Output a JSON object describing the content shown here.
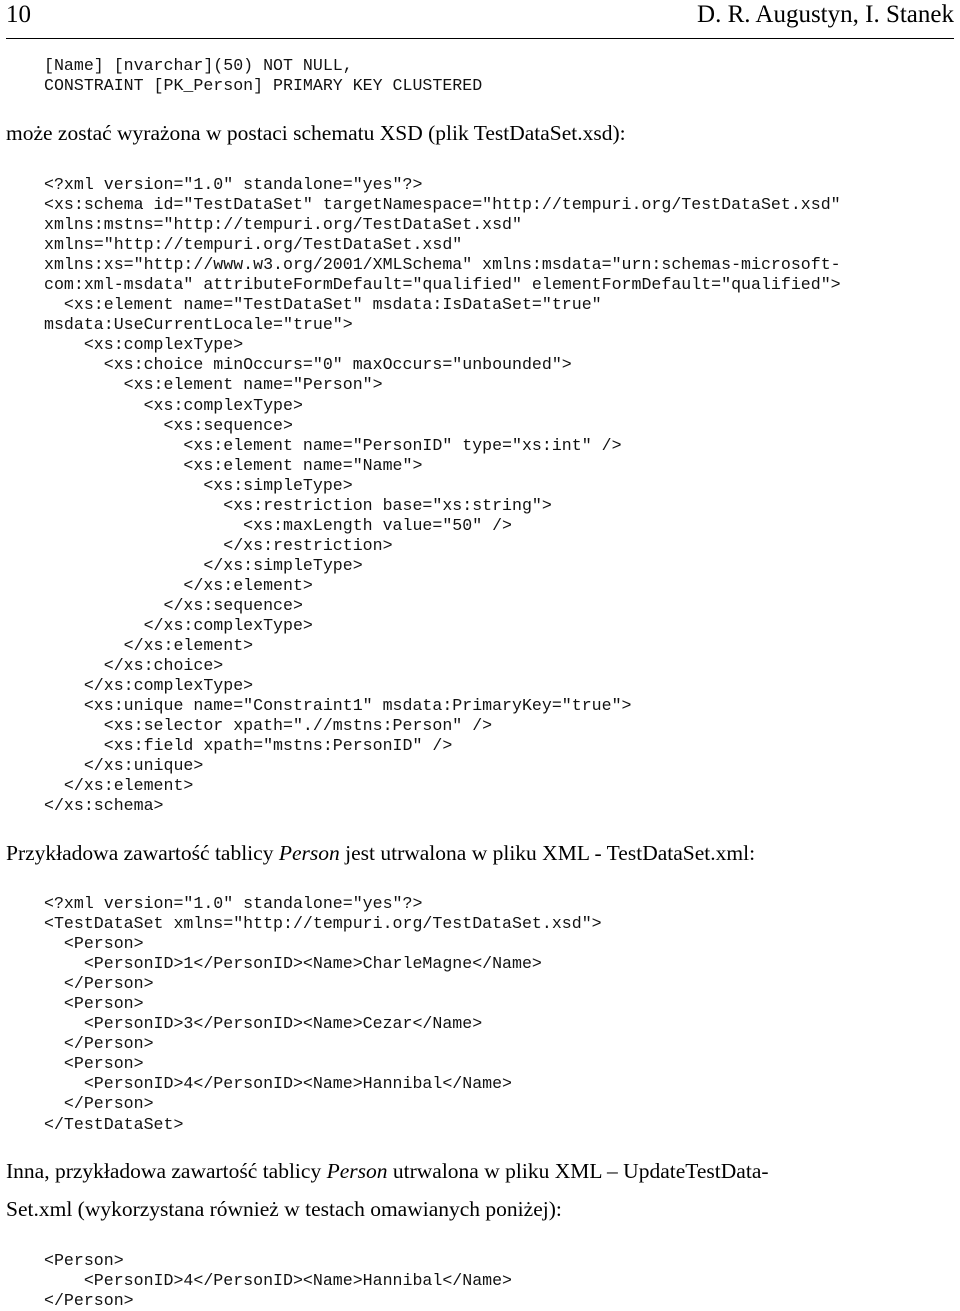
{
  "header": {
    "page_number": "10",
    "authors": "D. R. Augustyn, I. Stanek"
  },
  "code_sql": [
    "[Name] [nvarchar](50) NOT NULL,",
    "CONSTRAINT [PK_Person] PRIMARY KEY CLUSTERED"
  ],
  "para1": {
    "text": "może zostać wyrażona w postaci schematu XSD (plik  TestDataSet.xsd):"
  },
  "code_xsd": [
    "<?xml version=\"1.0\" standalone=\"yes\"?>",
    "<xs:schema id=\"TestDataSet\" targetNamespace=\"http://tempuri.org/TestDataSet.xsd\"",
    "xmlns:mstns=\"http://tempuri.org/TestDataSet.xsd\"",
    "xmlns=\"http://tempuri.org/TestDataSet.xsd\"",
    "xmlns:xs=\"http://www.w3.org/2001/XMLSchema\" xmlns:msdata=\"urn:schemas-microsoft-",
    "com:xml-msdata\" attributeFormDefault=\"qualified\" elementFormDefault=\"qualified\">",
    "  <xs:element name=\"TestDataSet\" msdata:IsDataSet=\"true\"",
    "msdata:UseCurrentLocale=\"true\">",
    "    <xs:complexType>",
    "      <xs:choice minOccurs=\"0\" maxOccurs=\"unbounded\">",
    "        <xs:element name=\"Person\">",
    "          <xs:complexType>",
    "            <xs:sequence>",
    "              <xs:element name=\"PersonID\" type=\"xs:int\" />",
    "              <xs:element name=\"Name\">",
    "                <xs:simpleType>",
    "                  <xs:restriction base=\"xs:string\">",
    "                    <xs:maxLength value=\"50\" />",
    "                  </xs:restriction>",
    "                </xs:simpleType>",
    "              </xs:element>",
    "            </xs:sequence>",
    "          </xs:complexType>",
    "        </xs:element>",
    "      </xs:choice>",
    "    </xs:complexType>",
    "    <xs:unique name=\"Constraint1\" msdata:PrimaryKey=\"true\">",
    "      <xs:selector xpath=\".//mstns:Person\" />",
    "      <xs:field xpath=\"mstns:PersonID\" />",
    "    </xs:unique>",
    "  </xs:element>",
    "</xs:schema>"
  ],
  "para2": {
    "before": "Przykładowa zawartość tablicy ",
    "italic": "Person",
    "after": " jest utrwalona w pliku XML - TestDataSet.xml:"
  },
  "code_xml": [
    "<?xml version=\"1.0\" standalone=\"yes\"?>",
    "<TestDataSet xmlns=\"http://tempuri.org/TestDataSet.xsd\">",
    "  <Person>",
    "    <PersonID>1</PersonID><Name>CharleMagne</Name>",
    "  </Person>",
    "  <Person>",
    "    <PersonID>3</PersonID><Name>Cezar</Name>",
    "  </Person>",
    "  <Person>",
    "    <PersonID>4</PersonID><Name>Hannibal</Name>",
    "  </Person>",
    "</TestDataSet>"
  ],
  "para3": {
    "before": "Inna, przykładowa zawartość tablicy ",
    "italic": "Person",
    "after": " utrwalona w pliku XML – UpdateTestData-",
    "line2": "Set.xml (wykorzystana również w testach omawianych poniżej):"
  },
  "code_update": [
    "<Person>",
    "    <PersonID>4</PersonID><Name>Hannibal</Name>",
    "</Person>"
  ]
}
